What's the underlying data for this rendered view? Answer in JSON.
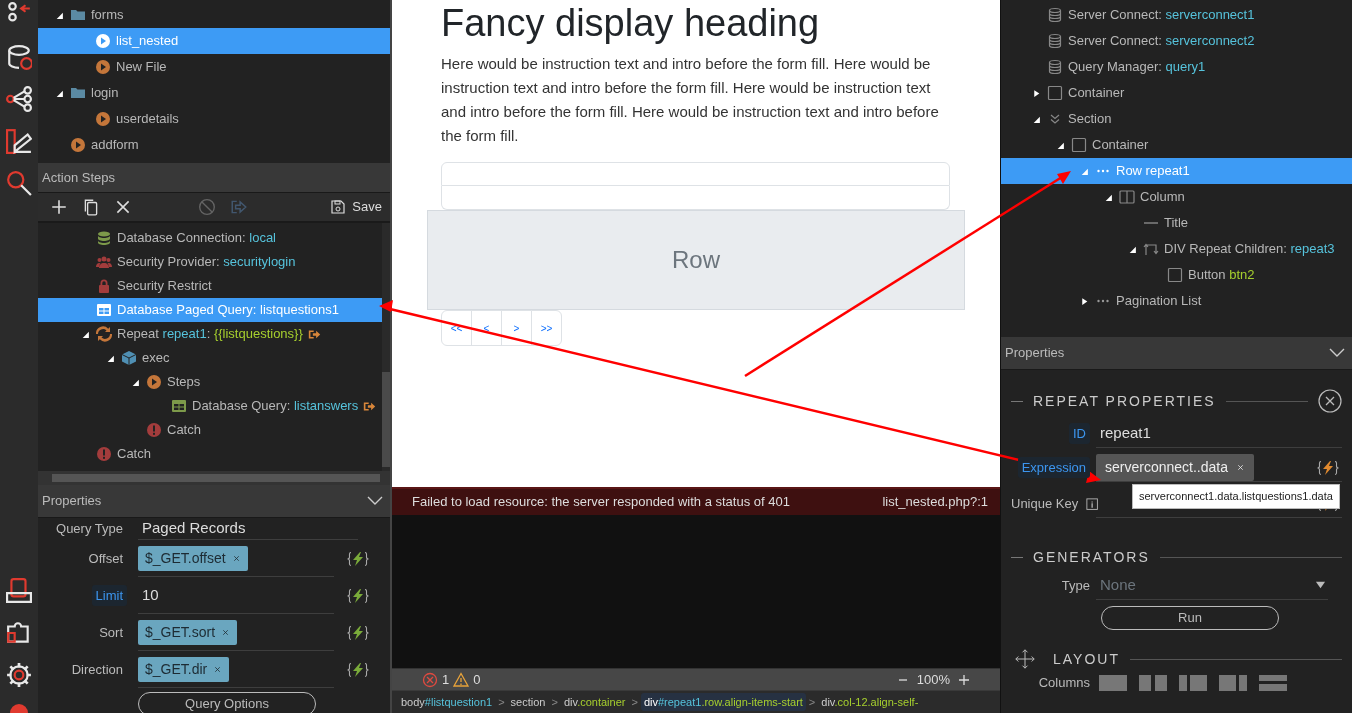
{
  "file_tree": {
    "items": [
      {
        "label": "forms",
        "kind": "folder",
        "expanded": true,
        "selected": false,
        "children": [
          {
            "label": "list_nested",
            "kind": "play",
            "selected": true
          },
          {
            "label": "New File",
            "kind": "play",
            "selected": false
          }
        ]
      },
      {
        "label": "login",
        "kind": "folder",
        "expanded": true,
        "selected": false,
        "children": [
          {
            "label": "userdetails",
            "kind": "play",
            "selected": false
          }
        ]
      },
      {
        "label": "addform",
        "kind": "play",
        "selected": false
      }
    ]
  },
  "action_steps": {
    "title": "Action Steps",
    "toolbar": [
      {
        "kind": "add",
        "disabled": false
      },
      {
        "kind": "copy",
        "disabled": false
      },
      {
        "kind": "delete",
        "disabled": false
      },
      {
        "kind": "disable",
        "disabled": true
      },
      {
        "kind": "export",
        "disabled": true
      }
    ],
    "save_label": "Save",
    "items": [
      {
        "kind": "database",
        "selected": false,
        "parts": [
          {
            "text": "Database Connection: ",
            "kind": "plain"
          },
          {
            "text": "local",
            "kind": "ref"
          }
        ]
      },
      {
        "kind": "users",
        "selected": false,
        "parts": [
          {
            "text": "Security Provider: ",
            "kind": "plain"
          },
          {
            "text": "securitylogin",
            "kind": "ref"
          }
        ]
      },
      {
        "kind": "lock",
        "selected": false,
        "parts": [
          {
            "text": "Security Restrict",
            "kind": "plain"
          }
        ]
      },
      {
        "kind": "table",
        "selected": true,
        "parts": [
          {
            "text": "Database Paged Query: ",
            "kind": "plain"
          },
          {
            "text": "listquestions1",
            "kind": "plain"
          }
        ]
      },
      {
        "kind": "repeat",
        "selected": false,
        "expanded": true,
        "output": true,
        "parts": [
          {
            "text": "Repeat ",
            "kind": "plain"
          },
          {
            "text": "repeat1",
            "kind": "ref"
          },
          {
            "text": ": ",
            "kind": "plain"
          },
          {
            "text": "{{listquestions}}",
            "kind": "code"
          }
        ],
        "children": [
          {
            "kind": "cube",
            "selected": false,
            "expanded": true,
            "parts": [
              {
                "text": "exec",
                "kind": "plain"
              }
            ],
            "children": [
              {
                "kind": "play",
                "selected": false,
                "expanded": true,
                "parts": [
                  {
                    "text": "Steps",
                    "kind": "plain"
                  }
                ],
                "children": [
                  {
                    "kind": "table",
                    "selected": false,
                    "output": true,
                    "parts": [
                      {
                        "text": "Database Query: ",
                        "kind": "plain"
                      },
                      {
                        "text": "listanswers",
                        "kind": "ref"
                      }
                    ]
                  }
                ]
              },
              {
                "kind": "alert",
                "selected": false,
                "parts": [
                  {
                    "text": "Catch",
                    "kind": "plain"
                  }
                ]
              }
            ]
          }
        ]
      },
      {
        "kind": "alert",
        "selected": false,
        "parts": [
          {
            "text": "Catch",
            "kind": "plain"
          }
        ]
      }
    ]
  },
  "left_properties": {
    "title": "Properties",
    "rows": [
      {
        "label": "Query Type",
        "kind": "text",
        "value": "Paged Records",
        "highlight": false
      },
      {
        "label": "Offset",
        "kind": "tag",
        "value": "$_GET.offset",
        "highlight": false,
        "dynamic": true
      },
      {
        "label": "Limit",
        "kind": "text",
        "value": "10",
        "highlight": true,
        "dynamic": true
      },
      {
        "label": "Sort",
        "kind": "tag",
        "value": "$_GET.sort",
        "highlight": false,
        "dynamic": true
      },
      {
        "label": "Direction",
        "kind": "tag",
        "value": "$_GET.dir",
        "highlight": false,
        "dynamic": true
      }
    ],
    "button": "Query Options"
  },
  "preview": {
    "heading": "Fancy display heading",
    "intro": "Here would be instruction text and intro before the form fill. Here would be instruction text and intro before the form fill. Here would be instruction text and intro before the form fill. Here would be instruction text and intro before the form fill.",
    "row_placeholder": "Row",
    "pagination": [
      "<<",
      "<",
      ">",
      ">>"
    ]
  },
  "console": {
    "messages": [
      {
        "text": "Failed to load resource: the server responded with a status of 401",
        "source": "list_nested.php?:1"
      }
    ],
    "errors": "1",
    "warnings": "0",
    "zoom": "100%"
  },
  "breadcrumb": [
    {
      "tag": "body",
      "id": "#listquestion1",
      "selected": false
    },
    {
      "separator": ">",
      "tag": "section",
      "selected": false
    },
    {
      "separator": ">",
      "tag": "div",
      "classes": ".container",
      "selected": false
    },
    {
      "separator": ">",
      "tag": "div",
      "id": "#repeat1",
      "classes": ".row.align-items-start",
      "selected": true
    },
    {
      "separator": ">",
      "tag": "div",
      "classes": ".col-12.align-self-",
      "selected": false
    }
  ],
  "structure_tree": {
    "items": [
      {
        "kind": "db-outline",
        "selected": false,
        "parts": [
          {
            "text": "Server Connect: ",
            "kind": "plain"
          },
          {
            "text": "serverconnect1",
            "kind": "ref"
          }
        ]
      },
      {
        "kind": "db-outline",
        "selected": false,
        "parts": [
          {
            "text": "Server Connect: ",
            "kind": "plain"
          },
          {
            "text": "serverconnect2",
            "kind": "ref"
          }
        ]
      },
      {
        "kind": "db-outline",
        "selected": false,
        "parts": [
          {
            "text": "Query Manager: ",
            "kind": "plain"
          },
          {
            "text": "query1",
            "kind": "ref"
          }
        ]
      },
      {
        "kind": "box",
        "selected": false,
        "expanded": false,
        "parts": [
          {
            "text": "Container",
            "kind": "plain"
          }
        ]
      },
      {
        "kind": "chevrons",
        "selected": false,
        "expanded": true,
        "parts": [
          {
            "text": "Section",
            "kind": "plain"
          }
        ],
        "children": [
          {
            "kind": "box",
            "selected": false,
            "expanded": true,
            "parts": [
              {
                "text": "Container",
                "kind": "plain"
              }
            ],
            "children": [
              {
                "kind": "dots",
                "selected": true,
                "expanded": true,
                "parts": [
                  {
                    "text": "Row repeat1",
                    "kind": "plain"
                  }
                ],
                "children": [
                  {
                    "kind": "columns",
                    "selected": false,
                    "expanded": true,
                    "parts": [
                      {
                        "text": "Column",
                        "kind": "plain"
                      }
                    ],
                    "children": [
                      {
                        "kind": "dash",
                        "selected": false,
                        "parts": [
                          {
                            "text": "Title",
                            "kind": "plain"
                          }
                        ]
                      },
                      {
                        "kind": "repeat-children",
                        "selected": false,
                        "expanded": true,
                        "parts": [
                          {
                            "text": "DIV Repeat Children: ",
                            "kind": "plain"
                          },
                          {
                            "text": "repeat3",
                            "kind": "ref"
                          }
                        ],
                        "children": [
                          {
                            "kind": "box",
                            "selected": false,
                            "parts": [
                              {
                                "text": "Button ",
                                "kind": "plain"
                              },
                              {
                                "text": "btn2",
                                "kind": "code"
                              }
                            ]
                          }
                        ]
                      }
                    ]
                  }
                ]
              },
              {
                "kind": "dots",
                "selected": false,
                "expanded": false,
                "parts": [
                  {
                    "text": "Pagination List",
                    "kind": "plain"
                  }
                ]
              }
            ]
          }
        ]
      }
    ]
  },
  "right_properties": {
    "title": "Properties",
    "repeat": {
      "title": "REPEAT PROPERTIES",
      "closable": true,
      "rows": [
        {
          "label": "ID",
          "kind": "text",
          "value": "repeat1",
          "highlight": true
        },
        {
          "label": "Expression",
          "kind": "tag",
          "value": "serverconnect..data",
          "highlight": true,
          "dynamic": true,
          "tooltip": "serverconnect1.data.listquestions1.data"
        },
        {
          "label": "Unique Key",
          "kind": "input",
          "info": true,
          "highlight": false,
          "dynamic": true
        }
      ]
    },
    "generators": {
      "title": "GENERATORS",
      "type_label": "Type",
      "type_value": "None",
      "button": "Run"
    },
    "layout": {
      "title": "LAYOUT",
      "columns_label": "Columns"
    }
  }
}
